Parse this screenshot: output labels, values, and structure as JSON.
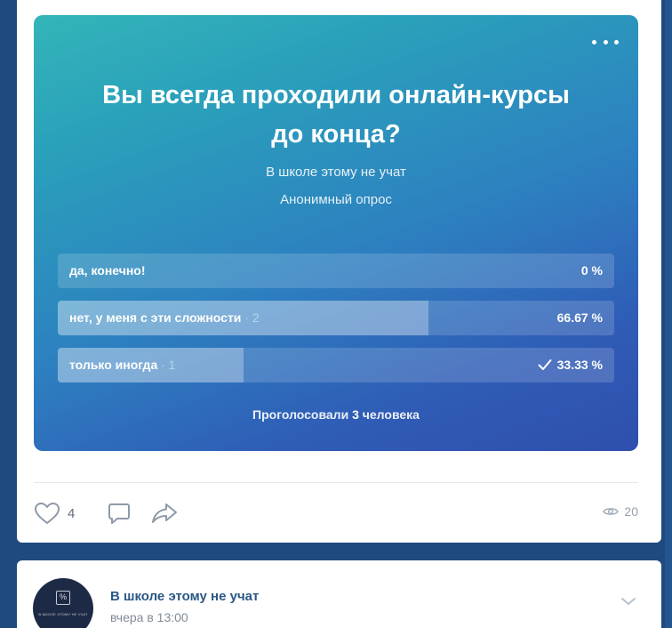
{
  "poll": {
    "question": "Вы всегда проходили онлайн-курсы до конца?",
    "author": "В школе этому не учат",
    "type": "Анонимный опрос",
    "answers": [
      {
        "label": "да, конечно!",
        "count": "",
        "percent": "0 %",
        "fraction": 0.0,
        "checked": false
      },
      {
        "label": "нет, у меня с эти сложности",
        "count": "· 2",
        "percent": "66.67 %",
        "fraction": 0.6667,
        "checked": false
      },
      {
        "label": "только иногда",
        "count": "· 1",
        "percent": "33.33 %",
        "fraction": 0.3333,
        "checked": true
      }
    ],
    "votes_prefix": "Проголосовали",
    "votes_count": "3",
    "votes_suffix": "человека"
  },
  "post": {
    "likes": "4",
    "views": "20"
  },
  "next_post": {
    "author": "В школе этому не учат",
    "time": "вчера в 13:00",
    "avatar_symbol": "%",
    "avatar_text": "В ШКОЛЕ ЭТОМУ НЕ УЧАТ"
  },
  "icons": {
    "menu": "more-horizontal-icon",
    "check": "check-icon",
    "like": "heart-icon",
    "comment": "comment-icon",
    "share": "share-icon",
    "views": "eye-icon",
    "expand": "chevron-down-icon"
  },
  "colors": {
    "page_background": "#1f4a80",
    "poll_gradient_start": "#33b5b8",
    "poll_gradient_end": "#2f4fad",
    "link": "#2a5885"
  }
}
